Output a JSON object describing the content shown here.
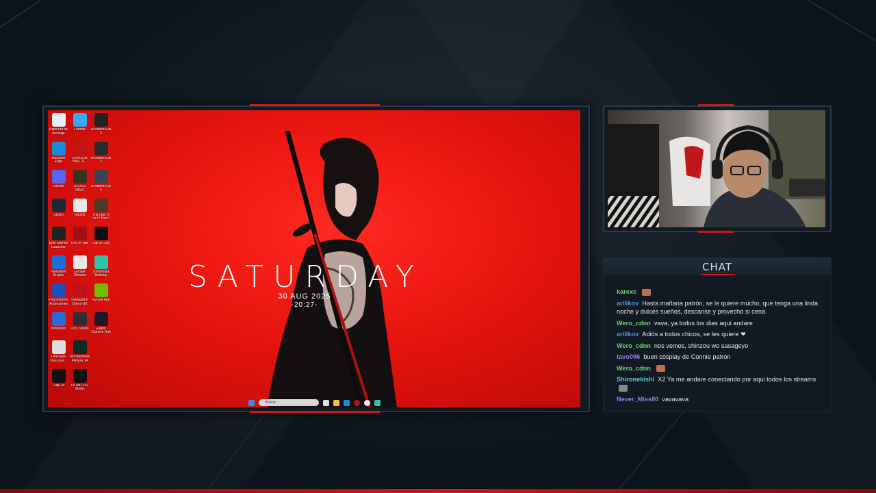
{
  "desktop": {
    "wallpaper_title": "SATURDAY",
    "wallpaper_date": "30 AUG 2025",
    "wallpaper_time": "-20:27-",
    "icons": [
      {
        "label": "Papelera de reciclaje",
        "icon": "recycle-bin-icon",
        "color": "#e8eef5"
      },
      {
        "label": "Fortnite",
        "icon": "fortnite-icon",
        "color": "#3aa8f0"
      },
      {
        "label": "Resident Evil 3",
        "icon": "resident-evil-icon",
        "color": "#222"
      },
      {
        "label": "Microsoft Edge",
        "icon": "edge-icon",
        "color": "#1b8ad8"
      },
      {
        "label": "DRAGON BALL S...",
        "icon": "dragonball-icon",
        "color": "#c21616"
      },
      {
        "label": "Resident Evil 2",
        "icon": "resident-evil-icon",
        "color": "#2a2a2a"
      },
      {
        "label": "Discord",
        "icon": "discord-icon",
        "color": "#5865f2"
      },
      {
        "label": "ELDEN RING",
        "icon": "elden-ring-icon",
        "color": "#3a3220"
      },
      {
        "label": "Resident Evil 4",
        "icon": "resident-evil-icon",
        "color": "#3a4450"
      },
      {
        "label": "Steam",
        "icon": "steam-icon",
        "color": "#1b2838"
      },
      {
        "label": "Roblox",
        "icon": "roblox-icon",
        "color": "#e8e8e8"
      },
      {
        "label": "The Last of Us™ Part I",
        "icon": "tlou-icon",
        "color": "#4a3a28"
      },
      {
        "label": "Epic Games Launcher",
        "icon": "epic-icon",
        "color": "#222"
      },
      {
        "label": "God of War",
        "icon": "god-of-war-icon",
        "color": "#a01010"
      },
      {
        "label": "Call of Duty",
        "icon": "cod-icon",
        "color": "#111"
      },
      {
        "label": "Wallpaper Engine",
        "icon": "wallpaper-engine-icon",
        "color": "#1c6fd8"
      },
      {
        "label": "Google Chrome",
        "icon": "chrome-icon",
        "color": "#e8e8e8"
      },
      {
        "label": "Streamlabs Desktop",
        "icon": "streamlabs-icon",
        "color": "#31c3a2"
      },
      {
        "label": "PlayStation® Accessories",
        "icon": "playstation-icon",
        "color": "#1f4fb8"
      },
      {
        "label": "Navegador Opera GX",
        "icon": "opera-gx-icon",
        "color": "#c0101a"
      },
      {
        "label": "NVIDIA App",
        "icon": "nvidia-icon",
        "color": "#76b900"
      },
      {
        "label": "Betteunet",
        "icon": "betternet-icon",
        "color": "#2a6ad8"
      },
      {
        "label": "OBS Studio",
        "icon": "obs-icon",
        "color": "#302e31"
      },
      {
        "label": "Elgato Camera Hub",
        "icon": "elgato-icon",
        "color": "#1a1a2a"
      },
      {
        "label": "Desculpe mas acer...",
        "icon": "app-icon",
        "color": "#ddd"
      },
      {
        "label": "Wondershare Filmora 14",
        "icon": "filmora-icon",
        "color": "#0c2a28"
      },
      {
        "label": "",
        "icon": "blank",
        "color": "transparent"
      },
      {
        "label": "CapCut",
        "icon": "capcut-icon",
        "color": "#111"
      },
      {
        "label": "TikTok LIVE Studio",
        "icon": "tiktok-icon",
        "color": "#111"
      },
      {
        "label": "",
        "icon": "blank",
        "color": "transparent"
      }
    ],
    "taskbar": {
      "search_placeholder": "Buscar"
    }
  },
  "chat": {
    "title": "CHAT",
    "messages": [
      {
        "user": "karexc",
        "color": "green",
        "text": "",
        "emote": true
      },
      {
        "user": "arilikov",
        "color": "blue",
        "text": "Hasta mañana patrón, se le quiere mucho, que tenga una linda noche y dulces sueños, descanse y provecho si cena",
        "emote": false
      },
      {
        "user": "Wero_cdnn",
        "color": "green",
        "text": "vava, ya todos los dias aqui andare",
        "emote": false
      },
      {
        "user": "arilikov",
        "color": "blue",
        "text": "Adiós a todos chicos, se les quiere ❤",
        "emote": false
      },
      {
        "user": "Wero_cdnn",
        "color": "green",
        "text": "nos vemos, shinzou wo sasageyo",
        "emote": false
      },
      {
        "user": "tavo096",
        "color": "purple",
        "text": "buen cosplay de Connie patrón",
        "emote": false
      },
      {
        "user": "Wero_cdnn",
        "color": "green",
        "text": "",
        "emote": true
      },
      {
        "user": "Shironekishi",
        "color": "teal",
        "text": "X2 Ya me andare conectando por aqui todos los streams",
        "emote": true
      },
      {
        "user": "Never_Miss80",
        "color": "purple",
        "text": "vavavava",
        "emote": false
      }
    ]
  }
}
